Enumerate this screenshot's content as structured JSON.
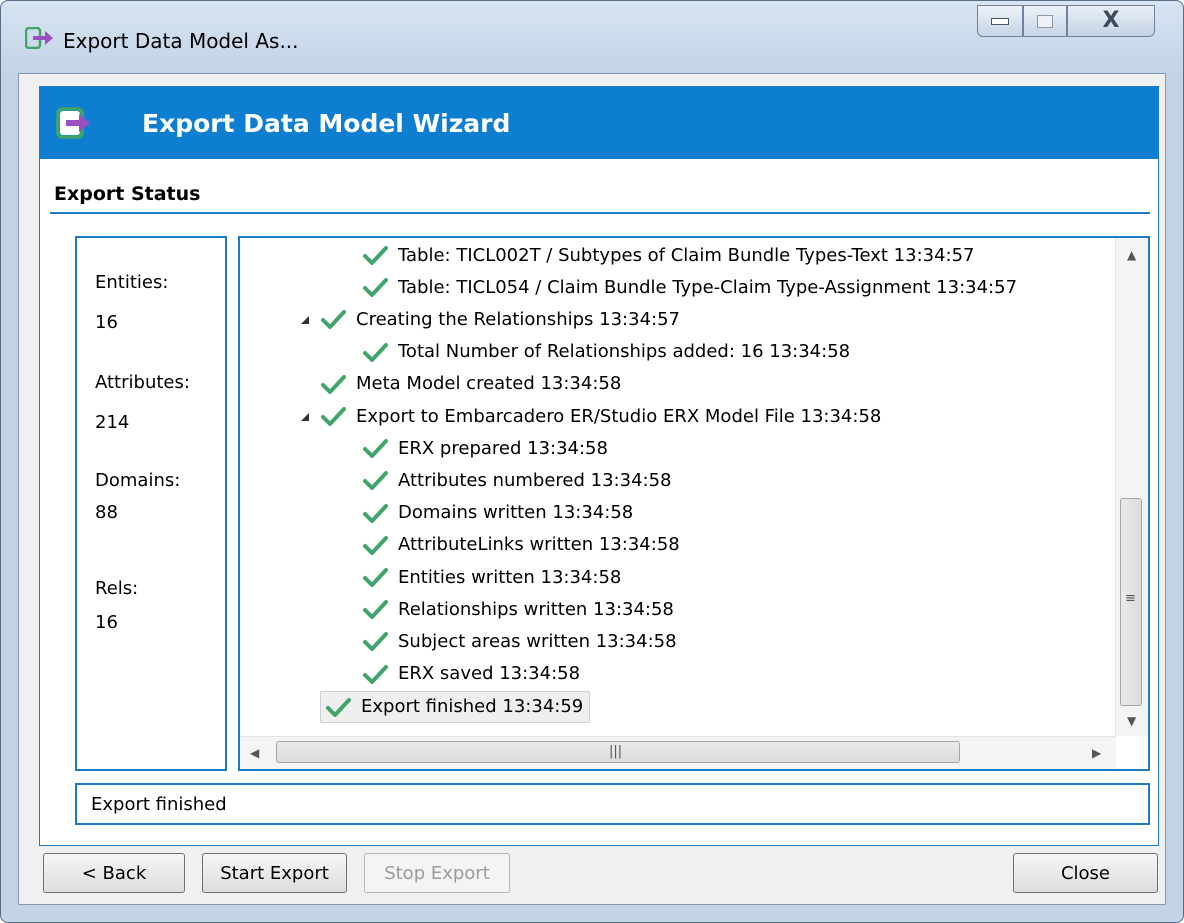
{
  "window": {
    "title": "Export Data Model As...",
    "close_glyph": "X"
  },
  "banner": {
    "title": "Export Data Model Wizard"
  },
  "section": {
    "title": "Export Status"
  },
  "stats": [
    {
      "label": "Entities:",
      "value": "16"
    },
    {
      "label": "Attributes:",
      "value": "214"
    },
    {
      "label": "Domains:",
      "value": "88"
    },
    {
      "label": "Rels:",
      "value": "16"
    }
  ],
  "log": [
    {
      "text": "Table: TICL002T / Subtypes of Claim Bundle Types-Text 13:34:57",
      "level": 2,
      "expander": false
    },
    {
      "text": "Table: TICL054 / Claim Bundle Type-Claim Type-Assignment 13:34:57",
      "level": 2,
      "expander": false
    },
    {
      "text": "Creating the Relationships 13:34:57",
      "level": 1,
      "expander": true
    },
    {
      "text": "Total Number of Relationships added: 16 13:34:58",
      "level": 2,
      "expander": false
    },
    {
      "text": "Meta Model created 13:34:58",
      "level": 1,
      "expander": false
    },
    {
      "text": "Export to Embarcadero ER/Studio ERX Model File 13:34:58",
      "level": 1,
      "expander": true
    },
    {
      "text": "ERX prepared 13:34:58",
      "level": 2,
      "expander": false
    },
    {
      "text": "Attributes numbered 13:34:58",
      "level": 2,
      "expander": false
    },
    {
      "text": "Domains written 13:34:58",
      "level": 2,
      "expander": false
    },
    {
      "text": "AttributeLinks written 13:34:58",
      "level": 2,
      "expander": false
    },
    {
      "text": "Entities written 13:34:58",
      "level": 2,
      "expander": false
    },
    {
      "text": "Relationships written 13:34:58",
      "level": 2,
      "expander": false
    },
    {
      "text": "Subject areas written 13:34:58",
      "level": 2,
      "expander": false
    },
    {
      "text": "ERX saved 13:34:58",
      "level": 2,
      "expander": false
    },
    {
      "text": "Export finished 13:34:59",
      "level": 0,
      "expander": false,
      "selected": true
    }
  ],
  "status": {
    "text": "Export finished"
  },
  "buttons": {
    "back": "< Back",
    "start": "Start Export",
    "stop": "Stop Export",
    "close": "Close"
  },
  "colors": {
    "accent": "#0e7fd0",
    "check": "#3fa56b",
    "icon_purple": "#9b4fc0"
  },
  "icons": {
    "window": "export-arrow-icon",
    "check": "checkmark-icon"
  }
}
